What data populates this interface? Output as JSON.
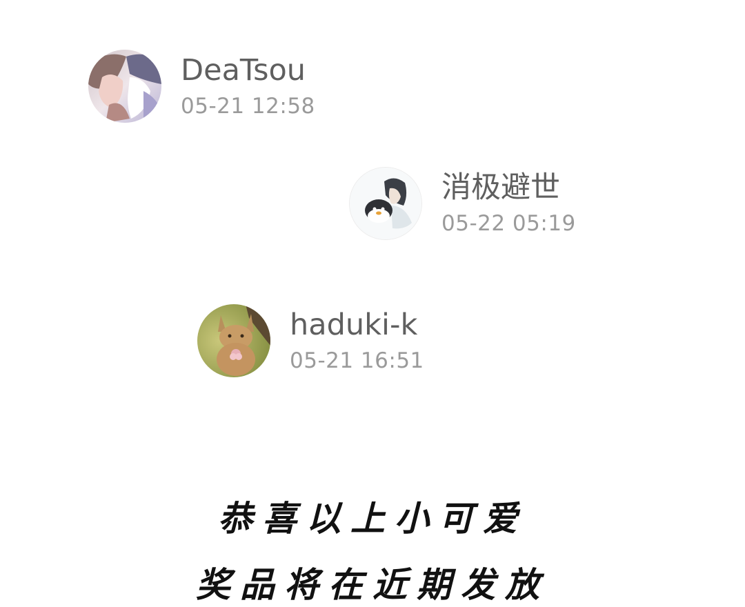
{
  "entries": [
    {
      "name": "DeaTsou",
      "time": "05-21 12:58",
      "avatar_icon": "anime-couple-avatar"
    },
    {
      "name": "消极避世",
      "time": "05-22 05:19",
      "avatar_icon": "penguin-chibi-avatar"
    },
    {
      "name": "haduki-k",
      "time": "05-21 16:51",
      "avatar_icon": "pikachu-figure-avatar"
    }
  ],
  "caption": {
    "line1": "恭喜以上小可爱",
    "line2": "奖品将在近期发放"
  }
}
